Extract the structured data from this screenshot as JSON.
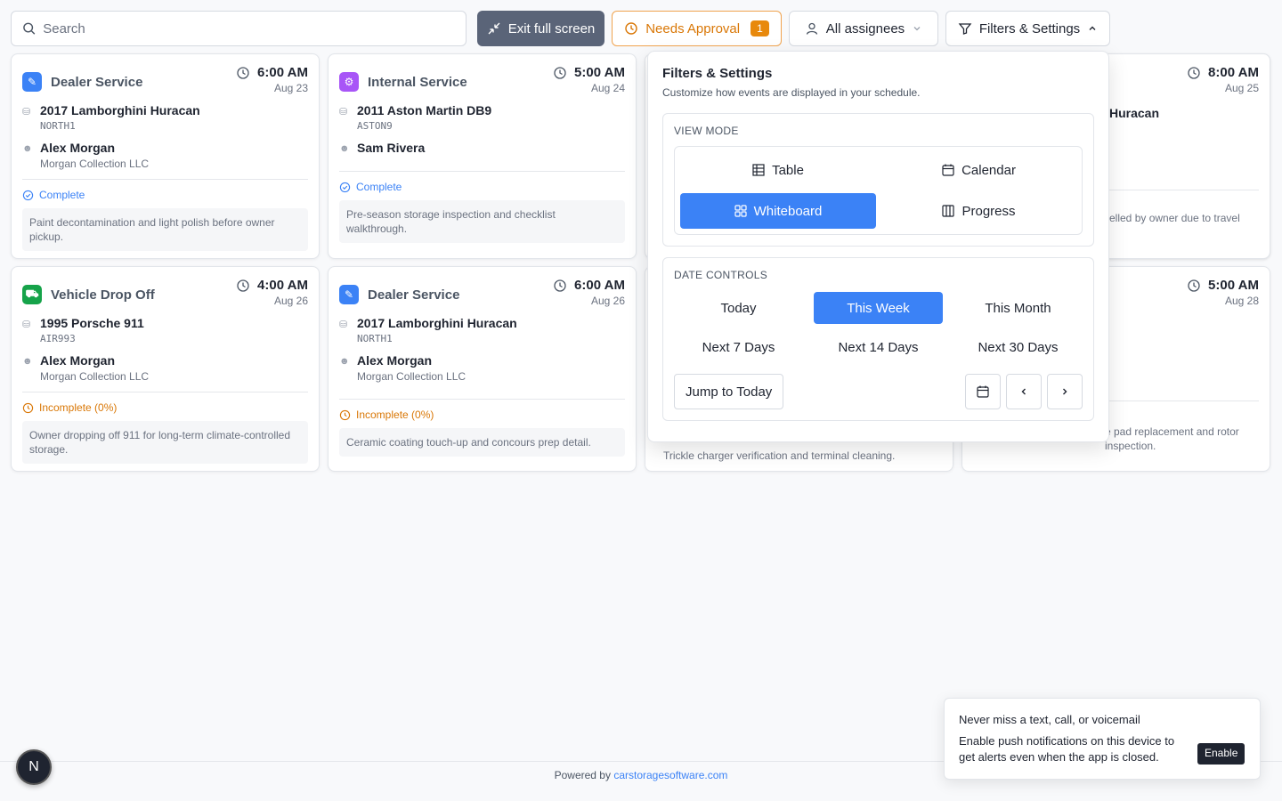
{
  "topbar": {
    "search_placeholder": "Search",
    "exit_label": "Exit full screen",
    "approval_label": "Needs Approval",
    "approval_count": "1",
    "assignees_label": "All assignees",
    "filters_label": "Filters & Settings"
  },
  "cards": [
    {
      "type": "Dealer Service",
      "type_color": "#3b82f6",
      "time": "6:00 AM",
      "date": "Aug 23",
      "vehicle": "2017 Lamborghini Huracan",
      "plate": "NORTH1",
      "person": "Alex Morgan",
      "company": "Morgan Collection LLC",
      "status": "Complete",
      "note": "Paint decontamination and light polish before owner pickup."
    },
    {
      "type": "Internal Service",
      "type_color": "#a855f7",
      "time": "5:00 AM",
      "date": "Aug 24",
      "vehicle": "2011 Aston Martin DB9",
      "plate": "ASTON9",
      "person": "Sam Rivera",
      "company": "",
      "status": "Complete",
      "note": "Pre-season storage inspection and checklist walkthrough."
    },
    {
      "type": "",
      "time": "8:00 AM",
      "date": "Aug 25",
      "vehicle": "Huracan",
      "note": "elled by owner due to travel"
    },
    {
      "type": "Vehicle Drop Off",
      "type_color": "#16a34a",
      "time": "4:00 AM",
      "date": "Aug 26",
      "vehicle": "1995 Porsche 911",
      "plate": "AIR993",
      "person": "Alex Morgan",
      "company": "Morgan Collection LLC",
      "status": "Incomplete (0%)",
      "note": "Owner dropping off 911 for long-term climate-controlled storage."
    },
    {
      "type": "Dealer Service",
      "type_color": "#3b82f6",
      "time": "6:00 AM",
      "date": "Aug 26",
      "vehicle": "2017 Lamborghini Huracan",
      "plate": "NORTH1",
      "person": "Alex Morgan",
      "company": "Morgan Collection LLC",
      "status": "Incomplete (0%)",
      "note": "Ceramic coating touch-up and concours prep detail."
    },
    {
      "note": "Trickle charger verification and terminal cleaning."
    },
    {
      "time": "5:00 AM",
      "date": "Aug 28",
      "note": "e pad replacement and rotor inspection."
    }
  ],
  "filters": {
    "title": "Filters & Settings",
    "subtitle": "Customize how events are displayed in your schedule.",
    "view_mode_label": "VIEW MODE",
    "view_modes": [
      "Table",
      "Calendar",
      "Whiteboard",
      "Progress"
    ],
    "active_view": "Whiteboard",
    "date_controls_label": "DATE CONTROLS",
    "date_ranges": [
      "Today",
      "This Week",
      "This Month",
      "Next 7 Days",
      "Next 14 Days",
      "Next 30 Days"
    ],
    "active_range": "This Week",
    "jump_label": "Jump to Today"
  },
  "footer": {
    "prefix": "Powered by",
    "link": "carstoragesoftware.com"
  },
  "avatar_initial": "N",
  "toast": {
    "title": "Never miss a text, call, or voicemail",
    "body": "Enable push notifications on this device to get alerts even when the app is closed.",
    "button": "Enable"
  }
}
